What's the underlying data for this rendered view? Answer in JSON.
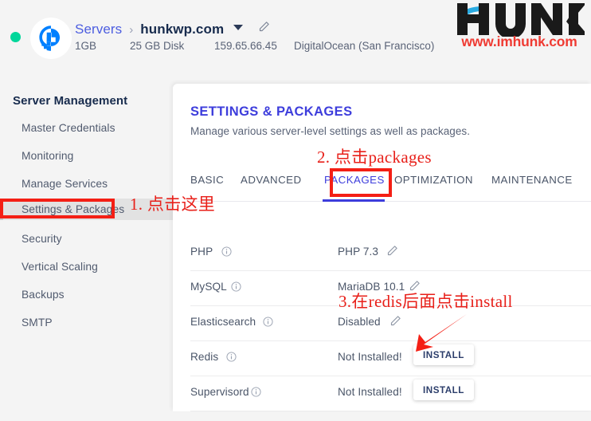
{
  "header": {
    "status_indicator": "online",
    "provider_icon": "digitalocean-logo",
    "breadcrumb_root": "Servers",
    "breadcrumb_separator": "›",
    "server_name": "hunkwp.com",
    "dropdown_icon": "chevron-down-icon",
    "edit_icon": "pencil-icon",
    "meta": {
      "ram": "1GB",
      "disk": "25 GB Disk",
      "ip": "159.65.66.45",
      "provider": "DigitalOcean (San Francisco)"
    }
  },
  "logo": {
    "wordmark": "HUNK",
    "url": "www.imhunk.com",
    "wordmark_color": "#1a1a1a",
    "accent_color": "#29abe2",
    "url_color": "#ef3b33"
  },
  "sidebar": {
    "title": "Server Management",
    "items": [
      {
        "label": "Master Credentials",
        "active": false
      },
      {
        "label": "Monitoring",
        "active": false
      },
      {
        "label": "Manage Services",
        "active": false
      },
      {
        "label": "Settings & Packages",
        "active": true
      },
      {
        "label": "Security",
        "active": false
      },
      {
        "label": "Vertical Scaling",
        "active": false
      },
      {
        "label": "Backups",
        "active": false
      },
      {
        "label": "SMTP",
        "active": false
      }
    ]
  },
  "main": {
    "title": "SETTINGS & PACKAGES",
    "subtitle": "Manage various server-level settings as well as packages.",
    "title_color": "#3d3ddc",
    "tabs": [
      {
        "label": "BASIC",
        "active": false
      },
      {
        "label": "ADVANCED",
        "active": false
      },
      {
        "label": "PACKAGES",
        "active": true
      },
      {
        "label": "OPTIMIZATION",
        "active": false
      },
      {
        "label": "MAINTENANCE",
        "active": false
      }
    ],
    "packages": [
      {
        "name": "PHP",
        "info_icon": "info-icon",
        "value": "PHP 7.3",
        "action": "edit",
        "action_label": ""
      },
      {
        "name": "MySQL",
        "info_icon": "info-icon",
        "value": "MariaDB 10.1",
        "action": "edit",
        "action_label": ""
      },
      {
        "name": "Elasticsearch",
        "info_icon": "info-icon",
        "value": "Disabled",
        "action": "edit",
        "action_label": ""
      },
      {
        "name": "Redis",
        "info_icon": "info-icon",
        "value": "Not Installed!",
        "action": "install",
        "action_label": "INSTALL"
      },
      {
        "name": "Supervisord",
        "info_icon": "info-icon",
        "value": "Not Installed!",
        "action": "install",
        "action_label": "INSTALL"
      }
    ]
  },
  "annotations": {
    "color": "#e8201a",
    "step1": "1. 点击这里",
    "step2": "2. 点击packages",
    "step3": "3.在redis后面点击install"
  }
}
